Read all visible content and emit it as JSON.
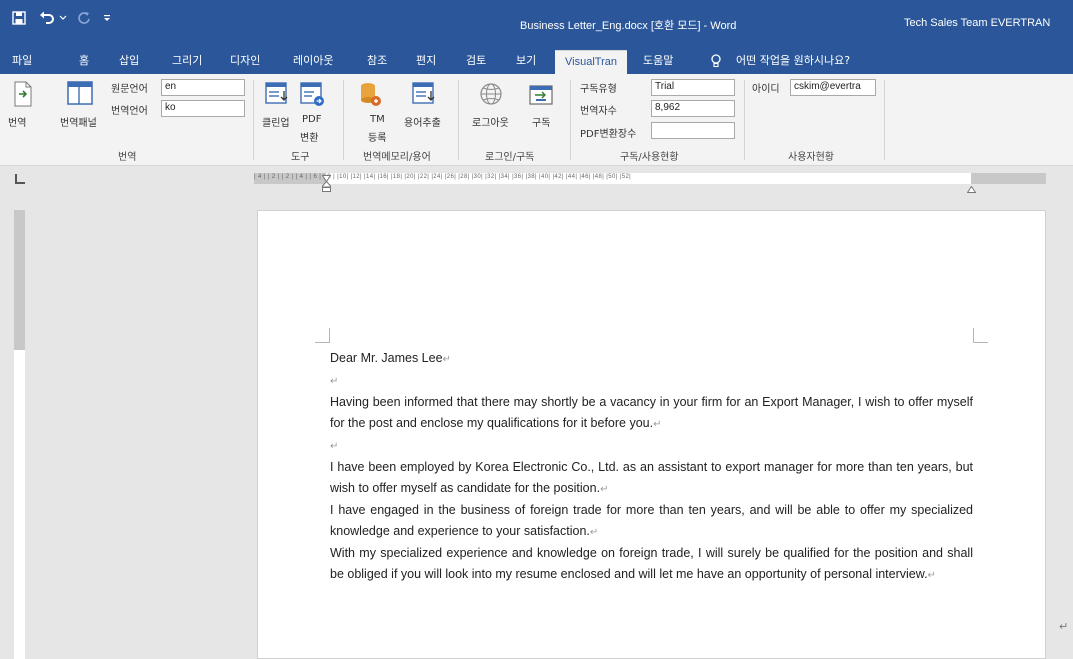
{
  "titlebar": {
    "doc_title": "Business Letter_Eng.docx [호환 모드] - Word",
    "account": "Tech Sales Team EVERTRAN",
    "qat_icons": [
      "save-icon",
      "undo-icon",
      "redo-icon",
      "customize-qat-icon"
    ]
  },
  "tabs": [
    {
      "label": "파일"
    },
    {
      "label": "홈"
    },
    {
      "label": "삽입"
    },
    {
      "label": "그리기"
    },
    {
      "label": "디자인"
    },
    {
      "label": "레이아웃"
    },
    {
      "label": "참조"
    },
    {
      "label": "편지"
    },
    {
      "label": "검토"
    },
    {
      "label": "보기"
    },
    {
      "label": "VisualTran"
    },
    {
      "label": "도움말"
    }
  ],
  "tell_me": "어떤 작업을 원하시나요?",
  "ribbon": {
    "translate_group": {
      "translate": "번역",
      "translate_panel": "번역패널",
      "source_lang_label": "원문언어",
      "source_lang_value": "en",
      "target_lang_label": "번역언어",
      "target_lang_value": "ko",
      "group_label": "번역"
    },
    "tools_group": {
      "cleanup": "클린업",
      "pdf_line1": "PDF",
      "pdf_line2": "변환",
      "group_label": "도구"
    },
    "tm_group": {
      "tm_line1": "TM",
      "tm_line2": "등록",
      "term_extract": "용어추출",
      "group_label": "번역메모리/용어"
    },
    "login_group": {
      "logout": "로그아웃",
      "subscribe": "구독",
      "group_label": "로그인/구독"
    },
    "subscription_group": {
      "type_label": "구독유형",
      "type_value": "Trial",
      "chars_label": "번역자수",
      "chars_value": "8,962",
      "pdf_label": "PDF변환장수",
      "pdf_value": "",
      "group_label": "구독/사용현황"
    },
    "user_group": {
      "id_label": "아이디",
      "id_value": "cskim@evertra",
      "group_label": "사용자현황"
    }
  },
  "ruler": {
    "text": "| 4 |  | 2 |       | 2 |  | 4 |  | 6 |  | 8 |  |10|  |12|  |14|  |16|  |18|  |20|  |22|  |24|  |26|  |28|  |30|  |32|  |34|  |36|  |38|  |40|  |42|  |44|  |46|  |48|  |50|  |52|"
  },
  "document": {
    "paragraphs": [
      {
        "text": "Dear Mr. James Lee",
        "justify": false
      },
      {
        "text": "",
        "justify": false
      },
      {
        "text": "Having been informed that there may shortly be a vacancy in your firm for an Export Manager, I wish to offer myself for the post and enclose my qualifications for it before you.",
        "justify": true
      },
      {
        "text": "",
        "justify": false
      },
      {
        "text": "I have been employed by Korea Electronic Co., Ltd. as an assistant to export manager for more than ten years, but wish to offer myself as candidate for the position.",
        "justify": true
      },
      {
        "text": "I have engaged in the business of foreign trade for more than ten years, and will be able to offer my specialized knowledge and experience to your satisfaction.",
        "justify": true
      },
      {
        "text": "With my specialized experience and knowledge on foreign trade, I will surely be qualified for the position and shall be obliged if you will look into my resume enclosed and will let me have an opportunity of personal interview.",
        "justify": true
      }
    ],
    "paragraph_mark": "↵"
  },
  "colors": {
    "title_bar": "#2b579a",
    "ribbon_bg": "#f3f3f3",
    "workspace_bg": "#e6e6e6"
  }
}
